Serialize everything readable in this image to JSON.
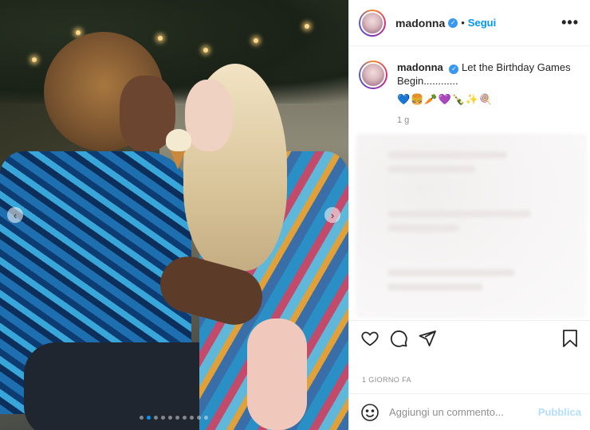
{
  "post": {
    "username": "madonna",
    "verified": true,
    "follow_separator": "•",
    "follow_label": "Segui",
    "more_label": "•••",
    "caption_text": "Let the Birthday Games Begin............",
    "caption_emojis": "💙🍔🥕💜🍾✨🍭",
    "caption_time": "1 g",
    "time_ago": "1 GIORNO FA",
    "comment_placeholder": "Aggiungi un commento...",
    "publish_label": "Pubblica"
  },
  "carousel": {
    "prev_label": "‹",
    "next_label": "›",
    "dots_total": 10,
    "active_dot": 1
  },
  "icons": {
    "header": [
      "avatar",
      "verified-badge-icon",
      "more-options-icon"
    ],
    "actions": [
      "heart-icon",
      "comment-icon",
      "share-icon",
      "bookmark-icon"
    ],
    "comment": [
      "emoji-icon"
    ]
  },
  "colors": {
    "accent": "#0095f6",
    "publish_disabled": "#b2dffc",
    "muted": "#8e8e8e",
    "text": "#262626",
    "divider": "#efefef"
  }
}
